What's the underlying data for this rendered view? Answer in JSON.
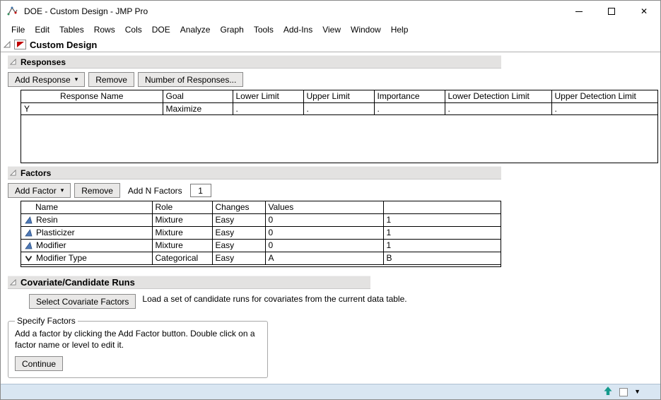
{
  "window": {
    "title": "DOE - Custom Design - JMP Pro"
  },
  "icons": {
    "close": "✕",
    "dropdown_arrow": "▾",
    "status_dropdown": "▼"
  },
  "colors": {
    "red_triangle": "#c00000",
    "mixture_icon": "#4d79b8",
    "status_arrow": "#159a8c",
    "section_header_bg": "#e3e2e1",
    "statusbar_bg": "#d9e6f2"
  },
  "menu": {
    "items": [
      "File",
      "Edit",
      "Tables",
      "Rows",
      "Cols",
      "DOE",
      "Analyze",
      "Graph",
      "Tools",
      "Add-Ins",
      "View",
      "Window",
      "Help"
    ]
  },
  "report": {
    "title": "Custom Design"
  },
  "responses": {
    "title": "Responses",
    "add_button": "Add Response",
    "remove_button": "Remove",
    "number_button": "Number of Responses...",
    "columns": [
      "Response Name",
      "Goal",
      "Lower Limit",
      "Upper Limit",
      "Importance",
      "Lower Detection Limit",
      "Upper Detection Limit"
    ],
    "rows": [
      {
        "name": "Y",
        "goal": "Maximize",
        "lower_limit": ".",
        "upper_limit": ".",
        "importance": ".",
        "lower_detection_limit": ".",
        "upper_detection_limit": "."
      }
    ]
  },
  "factors": {
    "title": "Factors",
    "add_button": "Add Factor",
    "remove_button": "Remove",
    "add_n_label": "Add N Factors",
    "add_n_value": "1",
    "columns": [
      "Name",
      "Role",
      "Changes",
      "Values"
    ],
    "rows": [
      {
        "icon": "mixture",
        "name": "Resin",
        "role": "Mixture",
        "changes": "Easy",
        "value1": "0",
        "value2": "1"
      },
      {
        "icon": "mixture",
        "name": "Plasticizer",
        "role": "Mixture",
        "changes": "Easy",
        "value1": "0",
        "value2": "1"
      },
      {
        "icon": "mixture",
        "name": "Modifier",
        "role": "Mixture",
        "changes": "Easy",
        "value1": "0",
        "value2": "1"
      },
      {
        "icon": "categorical",
        "name": "Modifier Type",
        "role": "Categorical",
        "changes": "Easy",
        "value1": "A",
        "value2": "B"
      }
    ]
  },
  "covariate": {
    "title": "Covariate/Candidate Runs",
    "select_button": "Select Covariate Factors",
    "description": "Load a set of candidate runs for covariates from the current data table."
  },
  "specify_factors": {
    "legend": "Specify Factors",
    "instructions": "Add a factor by clicking the Add Factor button. Double click on a factor name or level to edit it.",
    "continue_button": "Continue"
  }
}
